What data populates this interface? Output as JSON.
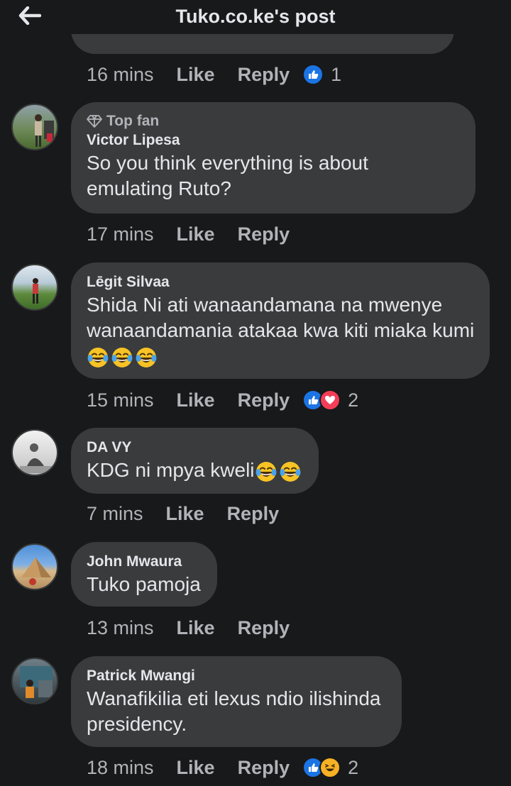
{
  "header": {
    "title": "Tuko.co.ke's post"
  },
  "prev_meta": {
    "time": "16 mins",
    "like": "Like",
    "reply": "Reply",
    "count": "1"
  },
  "comments": [
    {
      "badge": "Top fan",
      "author": "Victor Lipesa",
      "text": "So you think everything is about emulating Ruto?",
      "time": "17 mins",
      "like": "Like",
      "reply": "Reply",
      "reaction_count": ""
    },
    {
      "badge": "",
      "author": "Lēgit Silvaa",
      "text": "Shida Ni ati wanaandamana na mwenye wanaandamania atakaa kwa kiti miaka kumi",
      "emojis": [
        "laughing-tears",
        "laughing-tears",
        "laughing-tears"
      ],
      "time": "15 mins",
      "like": "Like",
      "reply": "Reply",
      "reaction_count": "2"
    },
    {
      "badge": "",
      "author": "DA VY",
      "text": "KDG ni mpya kweli",
      "emojis": [
        "laughing-tears",
        "laughing-tears"
      ],
      "time": "7 mins",
      "like": "Like",
      "reply": "Reply",
      "reaction_count": ""
    },
    {
      "badge": "",
      "author": "John Mwaura",
      "text": "Tuko pamoja",
      "time": "13 mins",
      "like": "Like",
      "reply": "Reply",
      "reaction_count": ""
    },
    {
      "badge": "",
      "author": "Patrick Mwangi",
      "text": "Wanafikilia eti lexus ndio ilishinda presidency.",
      "time": "18 mins",
      "like": "Like",
      "reply": "Reply",
      "reaction_count": "2"
    }
  ],
  "colors": {
    "background": "#18191a",
    "bubble": "#3a3b3c",
    "like_blue": "#1b74e4",
    "love_red": "#f33e58",
    "haha_yellow": "#f7b125"
  }
}
